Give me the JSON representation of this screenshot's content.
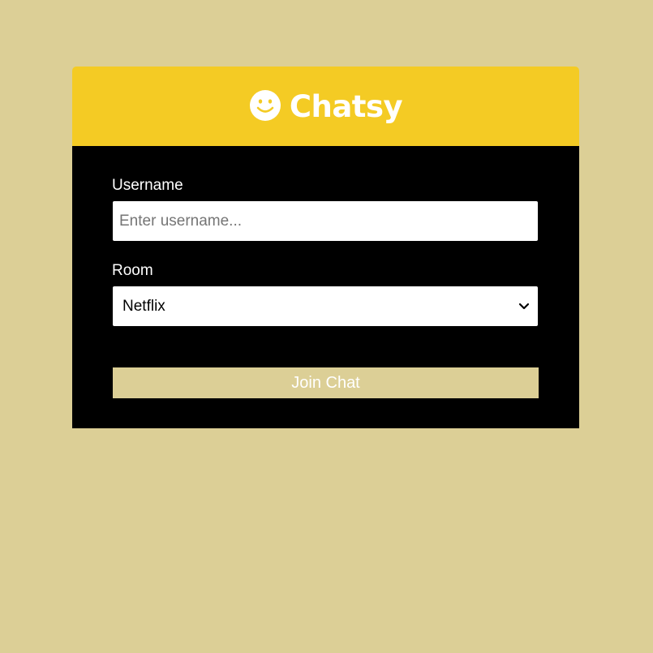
{
  "header": {
    "title": "Chatsy",
    "logo_icon": "smiley-face-icon"
  },
  "form": {
    "username_label": "Username",
    "username_placeholder": "Enter username...",
    "username_value": "",
    "room_label": "Room",
    "room_selected": "Netflix",
    "join_label": "Join Chat"
  },
  "colors": {
    "page_background": "#dccf96",
    "header_background": "#f4cb24",
    "body_background": "#000000",
    "button_background": "#dccf96"
  }
}
